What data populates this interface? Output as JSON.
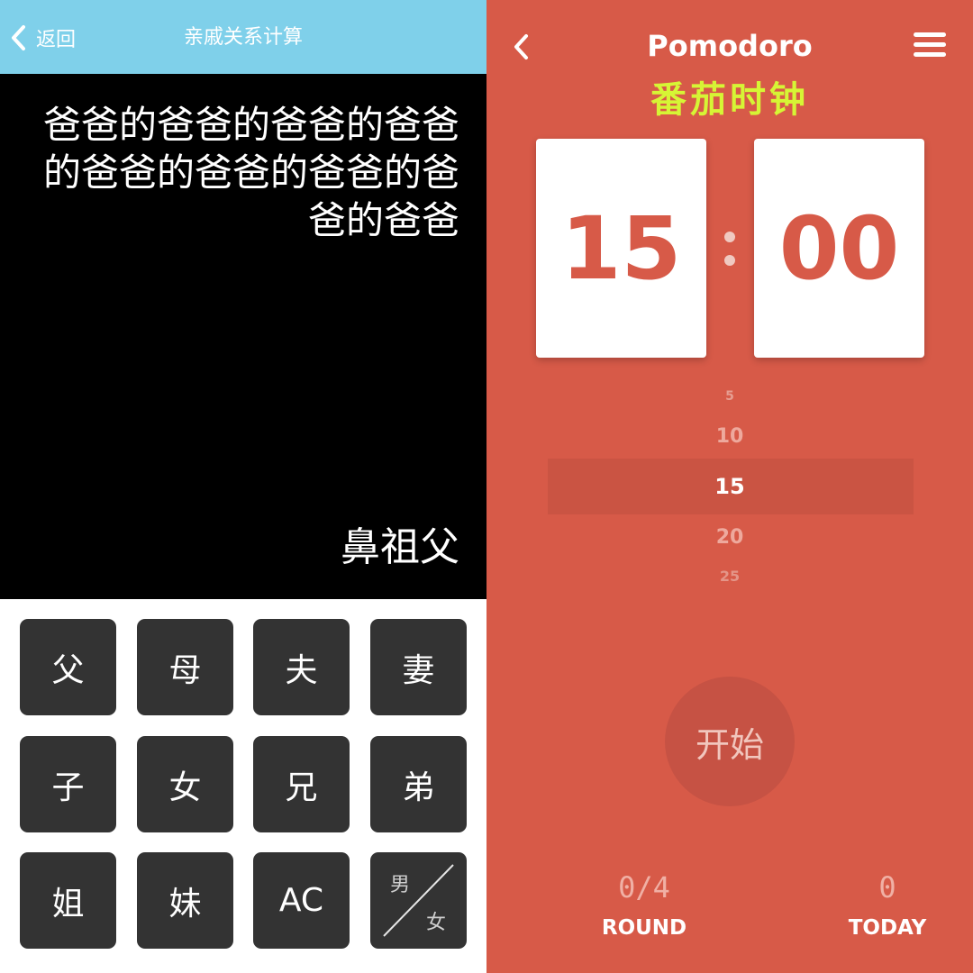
{
  "left": {
    "header": {
      "back_label": "返回",
      "title": "亲戚关系计算",
      "bg_color": "#7fd0ea"
    },
    "display": {
      "expression": "爸爸的爸爸的爸爸的爸爸的爸爸的爸爸的爸爸的爸爸的爸爸",
      "result": "鼻祖父"
    },
    "keys": [
      [
        "父",
        "母",
        "夫",
        "妻"
      ],
      [
        "子",
        "女",
        "兄",
        "弟"
      ],
      [
        "姐",
        "妹",
        "AC"
      ]
    ],
    "gender_key": {
      "male": "男",
      "female": "女"
    }
  },
  "right": {
    "header": {
      "title": "Pomodoro",
      "subtitle": "番茄时钟"
    },
    "timer": {
      "minutes": "15",
      "seconds": "00"
    },
    "picker": {
      "options": [
        "5",
        "10",
        "15",
        "20",
        "25"
      ],
      "selected": "15"
    },
    "start_label": "开始",
    "stats": [
      {
        "value": "0/4",
        "label": "ROUND"
      },
      {
        "value": "0",
        "label": "TODAY"
      }
    ],
    "colors": {
      "background": "#d75a48",
      "subtitle": "#d6f535",
      "card": "#ffffff"
    }
  }
}
